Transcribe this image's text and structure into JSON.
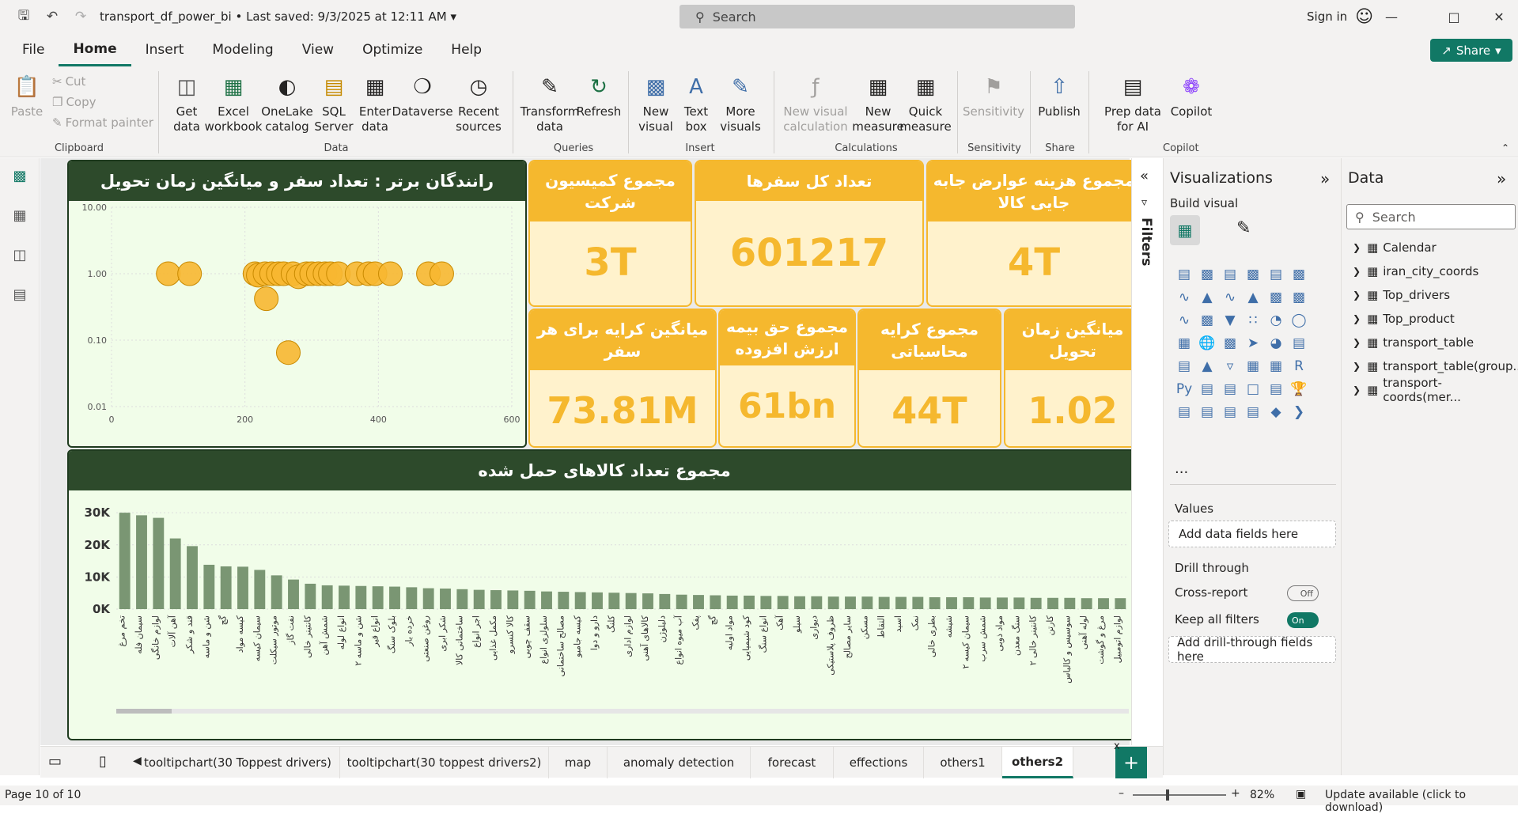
{
  "titlebar": {
    "doc_title": "transport_df_power_bi",
    "saved": "Last saved: 9/3/2025 at 12:11 AM",
    "search_placeholder": "Search",
    "signin": "Sign in"
  },
  "menu": {
    "items": [
      "File",
      "Home",
      "Insert",
      "Modeling",
      "View",
      "Optimize",
      "Help"
    ],
    "active": "Home",
    "share": "Share"
  },
  "ribbon": {
    "clipboard": {
      "paste": "Paste",
      "cut": "Cut",
      "copy": "Copy",
      "format_painter": "Format painter",
      "label": "Clipboard"
    },
    "data": {
      "get_data": "Get data",
      "excel": "Excel workbook",
      "onelake": "OneLake catalog",
      "sql": "SQL Server",
      "enter": "Enter data",
      "dataverse": "Dataverse",
      "recent": "Recent sources",
      "label": "Data"
    },
    "queries": {
      "transform": "Transform data",
      "refresh": "Refresh",
      "label": "Queries"
    },
    "insert": {
      "new_visual": "New visual",
      "text_box": "Text box",
      "more_visuals": "More visuals",
      "label": "Insert"
    },
    "calculations": {
      "new_visual_calc": "New visual calculation",
      "new_measure": "New measure",
      "quick_measure": "Quick measure",
      "label": "Calculations"
    },
    "sensitivity": {
      "sensitivity": "Sensitivity",
      "label": "Sensitivity"
    },
    "share": {
      "publish": "Publish",
      "label": "Share"
    },
    "copilot": {
      "prep": "Prep data for AI",
      "copilot": "Copilot",
      "label": "Copilot"
    }
  },
  "scatter": {
    "title": "رانندگان برتر : تعداد سفر و میانگین زمان تحویل",
    "y_ticks": [
      "10.00",
      "1.00",
      "0.10",
      "0.01"
    ],
    "x_ticks": [
      "0",
      "200",
      "400",
      "600"
    ]
  },
  "cards": [
    {
      "title": "مجموع کمیسیون شرکت",
      "value": "3T"
    },
    {
      "title": "تعداد کل سفرها",
      "value": "601217"
    },
    {
      "title": "مجموع هزینه عوارض جابه جایی کالا",
      "value": "4T"
    },
    {
      "title": "میانگین کرایه برای هر سفر",
      "value": "73.81M"
    },
    {
      "title": "مجموع حق بیمه ارزش افزوده",
      "value": "61bn"
    },
    {
      "title": "مجموع کرایه محاسباتی",
      "value": "44T"
    },
    {
      "title": "میانگین زمان تحویل",
      "value": "1.02"
    }
  ],
  "chart_data": [
    {
      "type": "scatter",
      "title": "رانندگان برتر : تعداد سفر و میانگین زمان تحویل",
      "y_scale": "log",
      "xlim": [
        0,
        600
      ],
      "ylim": [
        0.01,
        10
      ],
      "x": [
        85,
        117,
        215,
        220,
        230,
        232,
        240,
        250,
        258,
        265,
        272,
        280,
        292,
        300,
        310,
        320,
        328,
        340,
        368,
        385,
        395,
        418,
        475,
        495
      ],
      "y": [
        1.0,
        1.0,
        1.0,
        0.95,
        1.0,
        0.42,
        1.0,
        1.0,
        1.0,
        0.065,
        1.0,
        0.9,
        1.0,
        1.0,
        1.0,
        1.0,
        1.0,
        1.0,
        1.0,
        1.0,
        1.0,
        1.0,
        1.0,
        1.0
      ]
    },
    {
      "type": "bar",
      "title": "مجموع تعداد کالاهای حمل شده",
      "y_ticks": [
        "30K",
        "20K",
        "10K",
        "0K"
      ],
      "ylim": [
        0,
        32000
      ],
      "categories": [
        "تخم مرغ",
        "سیمان فله",
        "لوازم خانگی",
        "آهن آلات",
        "قند و شکر",
        "شن و ماسه",
        "گچ",
        "کیسه مواد",
        "سیمان کیسه",
        "موتور سیکلت",
        "نفت گاز",
        "کانتینر خالی",
        "شمش آهن",
        "انواع لوله",
        "شن و ماسه ۲",
        "انواع قیر",
        "بلوک سنگ",
        "خرده بار",
        "روغن صنعتی",
        "شکر ابری",
        "ساختمانی کالا",
        "اجر انواع",
        "مکمل غذایی",
        "کالا کنسرو",
        "سقف چوبی",
        "سلولزی انواع",
        "مصالح ساختمانی",
        "کیسه جامبو",
        "دارو و دوا",
        "کلنگ",
        "لوازم اداری",
        "کالاهای آهنی",
        "دلیلوژن",
        "آب میوه انواع",
        "پفک",
        "گچ",
        "مواد اولیه",
        "کود شیمیایی",
        "انواع سنگ",
        "آهک",
        "سیلو",
        "دیواری",
        "ظروف پلاستیکی",
        "سایر مصالح",
        "مسکن",
        "التقاط",
        "اسید",
        "نمک",
        "بطری خالی",
        "شیشه",
        "سیمان کیسه ۲",
        "شمش سرب",
        "مواد ذوبی",
        "سنگ معدن",
        "کانتینر خالی ۲",
        "کارتن",
        "سوسیس و کالباس",
        "لوله آهنی",
        "مرغ و گوشت",
        "لوازم اتومبیل"
      ],
      "values": [
        30000,
        29200,
        28400,
        22000,
        19600,
        13800,
        13300,
        13200,
        12200,
        10500,
        9200,
        7900,
        7400,
        7300,
        7200,
        7100,
        7000,
        6800,
        6500,
        6400,
        6200,
        6000,
        5900,
        5800,
        5700,
        5500,
        5400,
        5300,
        5200,
        5100,
        5000,
        4900,
        4700,
        4500,
        4400,
        4300,
        4200,
        4200,
        4100,
        4100,
        4000,
        4000,
        3900,
        3900,
        3900,
        3800,
        3800,
        3800,
        3700,
        3700,
        3700,
        3600,
        3600,
        3600,
        3500,
        3500,
        3500,
        3400,
        3400,
        3400
      ]
    }
  ],
  "barchart": {
    "title": "مجموع تعداد کالاهای حمل شده"
  },
  "filters": {
    "label": "Filters"
  },
  "viz": {
    "title": "Visualizations",
    "build": "Build visual",
    "values_label": "Values",
    "values_placeholder": "Add data fields here",
    "drill_label": "Drill through",
    "cross_report": "Cross-report",
    "cross_state": "Off",
    "keep_filters": "Keep all filters",
    "keep_state": "On",
    "drill_placeholder": "Add drill-through fields here",
    "more": "..."
  },
  "data_pane": {
    "title": "Data",
    "search": "Search",
    "tables": [
      "Calendar",
      "iran_city_coords",
      "Top_drivers",
      "Top_product",
      "transport_table",
      "transport_table(group...",
      "transport-coords(mer..."
    ]
  },
  "tabs": [
    "tooltipchart(30 Toppest drivers)",
    "tooltipchart(30 toppest drivers2)",
    "map",
    "anomaly detection",
    "forecast",
    "effections",
    "others1",
    "others2"
  ],
  "status": {
    "page": "Page 10 of 10",
    "zoom": "82%",
    "update": "Update available (click to download)"
  }
}
